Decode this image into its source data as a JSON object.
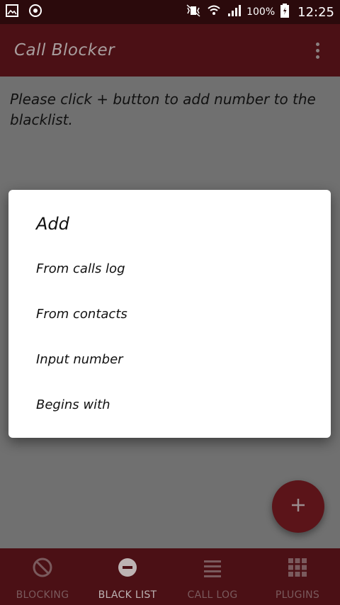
{
  "status_bar": {
    "battery": "100%",
    "time": "12:25"
  },
  "app_bar": {
    "title": "Call Blocker"
  },
  "content": {
    "hint": "Please click + button to add number to the blacklist."
  },
  "dialog": {
    "title": "Add",
    "items": [
      {
        "label": "From calls log"
      },
      {
        "label": "From contacts"
      },
      {
        "label": "Input number"
      },
      {
        "label": "Begins with"
      }
    ]
  },
  "fab": {
    "icon": "plus-icon"
  },
  "bottom_nav": {
    "items": [
      {
        "label": "BLOCKING",
        "icon": "block-icon"
      },
      {
        "label": "BLACK LIST",
        "icon": "minus-circle-icon"
      },
      {
        "label": "CALL LOG",
        "icon": "list-icon"
      },
      {
        "label": "PLUGINS",
        "icon": "grid-icon"
      }
    ],
    "active_index": 1
  },
  "colors": {
    "primary": "#4b1015",
    "accent": "#5b1419",
    "status_bar": "#2b0a0c"
  }
}
